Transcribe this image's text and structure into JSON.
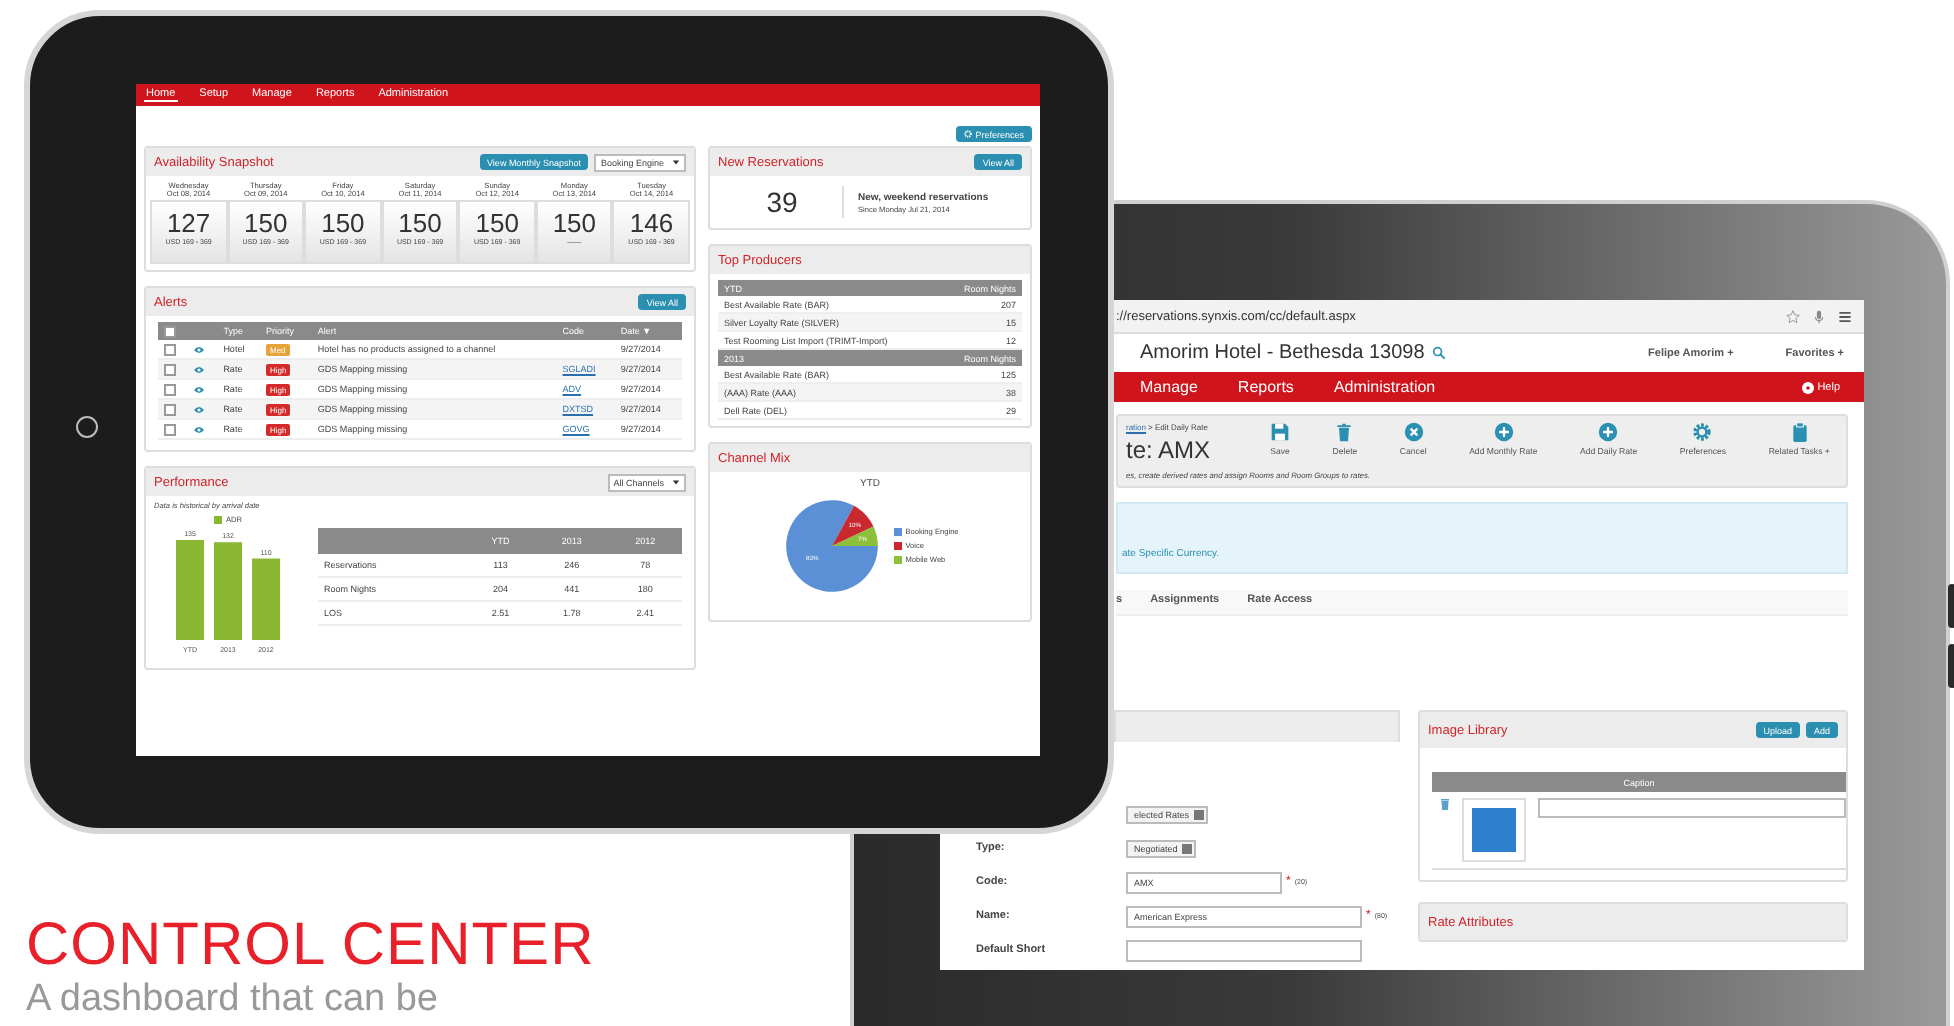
{
  "dashboard_tablet": {
    "nav": [
      {
        "label": "Home",
        "selected": true
      },
      {
        "label": "Setup",
        "selected": false
      },
      {
        "label": "Manage",
        "selected": false
      },
      {
        "label": "Reports",
        "selected": false
      },
      {
        "label": "Administration",
        "selected": false
      }
    ],
    "preferences_button": "Preferences",
    "availability": {
      "title": "Availability Snapshot",
      "button": "View Monthly Snapshot",
      "channel": "Booking Engine",
      "days": [
        {
          "day": "Wednesday",
          "date": "Oct 08, 2014",
          "count": "127",
          "range": "USD 169 - 369"
        },
        {
          "day": "Thursday",
          "date": "Oct 09, 2014",
          "count": "150",
          "range": "USD 169 - 369"
        },
        {
          "day": "Friday",
          "date": "Oct 10, 2014",
          "count": "150",
          "range": "USD 169 - 369"
        },
        {
          "day": "Saturday",
          "date": "Oct 11, 2014",
          "count": "150",
          "range": "USD 169 - 369"
        },
        {
          "day": "Sunday",
          "date": "Oct 12, 2014",
          "count": "150",
          "range": "USD 169 - 369"
        },
        {
          "day": "Monday",
          "date": "Oct 13, 2014",
          "count": "150",
          "range": "——"
        },
        {
          "day": "Tuesday",
          "date": "Oct 14, 2014",
          "count": "146",
          "range": "USD 169 - 369"
        }
      ]
    },
    "alerts": {
      "title": "Alerts",
      "button": "View All",
      "all_checked": false,
      "columns": [
        "Type",
        "Priority",
        "Alert",
        "Code",
        "Date ▼"
      ],
      "rows": [
        {
          "checked": false,
          "type": "Hotel",
          "priority": "Med",
          "color": "#e8a23a",
          "alert": "Hotel has no products assigned to a channel",
          "date": "9/27/2014"
        },
        {
          "checked": false,
          "type": "Rate",
          "priority": "High",
          "color": "#d42a2a",
          "alert": "GDS Mapping missing",
          "code": "SGLADI",
          "date": "9/27/2014"
        },
        {
          "checked": false,
          "type": "Rate",
          "priority": "High",
          "color": "#d42a2a",
          "alert": "GDS Mapping missing",
          "code": "ADV",
          "date": "9/27/2014"
        },
        {
          "checked": false,
          "type": "Rate",
          "priority": "High",
          "color": "#d42a2a",
          "alert": "GDS Mapping missing",
          "code": "DXTSD",
          "date": "9/27/2014"
        },
        {
          "checked": false,
          "type": "Rate",
          "priority": "High",
          "color": "#d42a2a",
          "alert": "GDS Mapping missing",
          "code": "GOVG",
          "date": "9/27/2014"
        }
      ]
    },
    "performance": {
      "title": "Performance",
      "filter": "All Channels",
      "note": "Data is historical by arrival date",
      "chart_data": {
        "type": "bar",
        "categories": [
          "YTD",
          "2013",
          "2012"
        ],
        "series": [
          {
            "name": "ADR",
            "color": "#8ab833",
            "values": [
              135,
              132,
              110
            ]
          }
        ],
        "data_labels": true
      },
      "columns": [
        "YTD",
        "2013",
        "2012"
      ],
      "rows": [
        {
          "label": "Reservations",
          "values": [
            "113",
            "246",
            "78"
          ]
        },
        {
          "label": "Room Nights",
          "values": [
            "204",
            "441",
            "180"
          ]
        },
        {
          "label": "LOS",
          "values": [
            "2.51",
            "1.78",
            "2.41"
          ]
        }
      ]
    },
    "new_reservations": {
      "title": "New Reservations",
      "button": "View All",
      "count": "39",
      "headline": "New, weekend reservations",
      "since": "Since Monday Jul 21, 2014"
    },
    "top_producers": {
      "title": "Top Producers",
      "groups": [
        {
          "period": "YTD",
          "column": "Room Nights",
          "rows": [
            {
              "name": "Best Available Rate (BAR)",
              "value": "207"
            },
            {
              "name": "Silver Loyalty Rate (SILVER)",
              "value": "15"
            },
            {
              "name": "Test Rooming List Import (TRIMT-Import)",
              "value": "12"
            }
          ]
        },
        {
          "period": "2013",
          "column": "Room Nights",
          "rows": [
            {
              "name": "Best Available Rate (BAR)",
              "value": "125"
            },
            {
              "name": "(AAA) Rate (AAA)",
              "value": "38"
            },
            {
              "name": "Dell Rate (DEL)",
              "value": "29"
            }
          ]
        }
      ]
    },
    "channel_mix": {
      "title": "Channel Mix",
      "chart_data": {
        "type": "pie",
        "title": "YTD",
        "categories": [
          "Booking Engine",
          "Voice",
          "Mobile Web"
        ],
        "values": [
          83,
          10,
          7
        ],
        "value_labels": [
          "83%",
          "10%",
          "7%"
        ]
      },
      "legend": [
        {
          "color": "#5b8fd6"
        },
        {
          "color": "#c8282e"
        },
        {
          "color": "#8cbf3a"
        }
      ]
    }
  },
  "editor_tablet": {
    "address": "://reservations.synxis.com/cc/default.aspx",
    "hotel": "Amorim Hotel - Bethesda 13098",
    "user": "Felipe Amorim +",
    "favorites": "Favorites +",
    "nav": [
      "Manage",
      "Reports",
      "Administration"
    ],
    "help": "Help",
    "breadcrumb_link": "ration",
    "breadcrumb": "> Edit Daily Rate",
    "title": "te: AMX",
    "actions": [
      {
        "label": "Save",
        "kind": "save"
      },
      {
        "label": "Delete",
        "kind": "delete"
      },
      {
        "label": "Cancel",
        "kind": "cancel"
      },
      {
        "label": "Add Monthly Rate",
        "kind": "add"
      },
      {
        "label": "Add Daily Rate",
        "kind": "add"
      },
      {
        "label": "Preferences",
        "kind": "settings"
      },
      {
        "label": "Related Tasks +",
        "kind": "tasks"
      }
    ],
    "description": "es, create derived rates and assign Rooms and Room Groups to rates.",
    "notice": "ate Specific Currency.",
    "tabs": [
      "s",
      "Assignments",
      "Rate Access"
    ],
    "form": [
      {
        "kind": "select",
        "value": "elected Rates"
      },
      {
        "label": "Type:",
        "kind": "select",
        "value": "Negotiated"
      },
      {
        "label": "Code:",
        "kind": "text",
        "value": "AMX",
        "marker": "*",
        "limit": "(20)"
      },
      {
        "label": "Name:",
        "kind": "text",
        "value": "American Express",
        "marker": "*",
        "limit": "(80)"
      },
      {
        "label": "Default Short",
        "kind": "text"
      }
    ],
    "image_library": {
      "title": "Image Library",
      "buttons": [
        "Upload",
        "Add"
      ],
      "caption_header": "Caption"
    },
    "rate_attributes": {
      "title": "Rate Attributes"
    }
  },
  "heading": "CONTROL CENTER",
  "subheading": "A dashboard that can be"
}
